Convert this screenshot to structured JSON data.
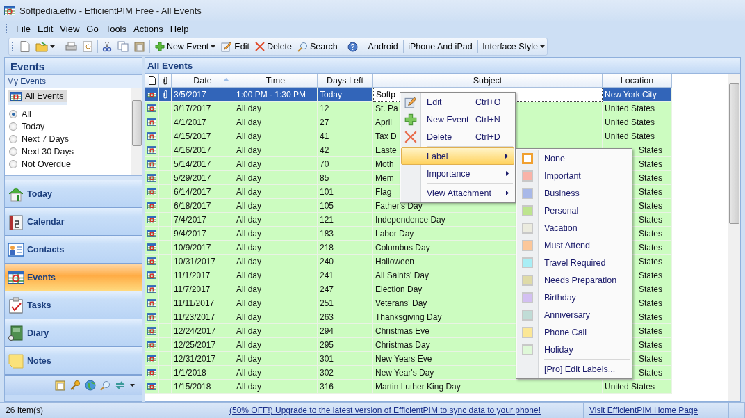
{
  "window": {
    "title": "Softpedia.effw - EfficientPIM Free - All Events"
  },
  "menu_bar": [
    "File",
    "Edit",
    "View",
    "Go",
    "Tools",
    "Actions",
    "Help"
  ],
  "toolbar": {
    "actions": [
      {
        "label": "New Event",
        "dropdown": true
      },
      {
        "label": "Edit",
        "dropdown": false
      },
      {
        "label": "Delete",
        "dropdown": false
      },
      {
        "label": "Search",
        "dropdown": false
      }
    ],
    "links": [
      {
        "label": "Android",
        "dropdown": false
      },
      {
        "label": "iPhone And iPad",
        "dropdown": false
      },
      {
        "label": "Interface Style",
        "dropdown": true
      }
    ]
  },
  "sidebar": {
    "title": "Events",
    "section": "My Events",
    "views": [
      {
        "label": "All Events",
        "selected": true
      }
    ],
    "filters": [
      {
        "label": "All",
        "selected": true
      },
      {
        "label": "Today",
        "selected": false
      },
      {
        "label": "Next 7 Days",
        "selected": false
      },
      {
        "label": "Next 30 Days",
        "selected": false
      },
      {
        "label": "Not Overdue",
        "selected": false
      }
    ],
    "nav": [
      {
        "label": "Today",
        "selected": false
      },
      {
        "label": "Calendar",
        "selected": false
      },
      {
        "label": "Contacts",
        "selected": false
      },
      {
        "label": "Events",
        "selected": true
      },
      {
        "label": "Tasks",
        "selected": false
      },
      {
        "label": "Diary",
        "selected": false
      },
      {
        "label": "Notes",
        "selected": false
      }
    ]
  },
  "table": {
    "title": "All Events",
    "columns": [
      {
        "label": "Date",
        "sorted": true
      },
      {
        "label": "Time",
        "sorted": false
      },
      {
        "label": "Days Left",
        "sorted": false
      },
      {
        "label": "Subject",
        "sorted": false
      },
      {
        "label": "Location",
        "sorted": false
      }
    ],
    "rows": [
      {
        "date": "3/5/2017",
        "time": "1:00 PM - 1:30 PM",
        "days_left": "Today",
        "subject": "Softp",
        "location": "New York City",
        "selected": true,
        "attachment": true,
        "location_cut": false
      },
      {
        "date": "3/17/2017",
        "time": "All day",
        "days_left": "12",
        "subject": "St. Pa",
        "location": "United States",
        "selected": false,
        "attachment": false,
        "location_cut": false
      },
      {
        "date": "4/1/2017",
        "time": "All day",
        "days_left": "27",
        "subject": "April",
        "location": "United States",
        "selected": false,
        "attachment": false,
        "location_cut": false
      },
      {
        "date": "4/15/2017",
        "time": "All day",
        "days_left": "41",
        "subject": "Tax D",
        "location": "United States",
        "selected": false,
        "attachment": false,
        "location_cut": false
      },
      {
        "date": "4/16/2017",
        "time": "All day",
        "days_left": "42",
        "subject": "Easte",
        "location": "States",
        "selected": false,
        "attachment": false,
        "location_cut": true
      },
      {
        "date": "5/14/2017",
        "time": "All day",
        "days_left": "70",
        "subject": "Moth",
        "location": "States",
        "selected": false,
        "attachment": false,
        "location_cut": true
      },
      {
        "date": "5/29/2017",
        "time": "All day",
        "days_left": "85",
        "subject": "Mem",
        "location": "States",
        "selected": false,
        "attachment": false,
        "location_cut": true
      },
      {
        "date": "6/14/2017",
        "time": "All day",
        "days_left": "101",
        "subject": "Flag",
        "location": "States",
        "selected": false,
        "attachment": false,
        "location_cut": true
      },
      {
        "date": "6/18/2017",
        "time": "All day",
        "days_left": "105",
        "subject": "Father's Day",
        "location": "States",
        "selected": false,
        "attachment": false,
        "location_cut": true
      },
      {
        "date": "7/4/2017",
        "time": "All day",
        "days_left": "121",
        "subject": "Independence Day",
        "location": "States",
        "selected": false,
        "attachment": false,
        "location_cut": true
      },
      {
        "date": "9/4/2017",
        "time": "All day",
        "days_left": "183",
        "subject": "Labor Day",
        "location": "States",
        "selected": false,
        "attachment": false,
        "location_cut": true
      },
      {
        "date": "10/9/2017",
        "time": "All day",
        "days_left": "218",
        "subject": "Columbus Day",
        "location": "States",
        "selected": false,
        "attachment": false,
        "location_cut": true
      },
      {
        "date": "10/31/2017",
        "time": "All day",
        "days_left": "240",
        "subject": "Halloween",
        "location": "States",
        "selected": false,
        "attachment": false,
        "location_cut": true
      },
      {
        "date": "11/1/2017",
        "time": "All day",
        "days_left": "241",
        "subject": "All Saints' Day",
        "location": "States",
        "selected": false,
        "attachment": false,
        "location_cut": true
      },
      {
        "date": "11/7/2017",
        "time": "All day",
        "days_left": "247",
        "subject": "Election Day",
        "location": "States",
        "selected": false,
        "attachment": false,
        "location_cut": true
      },
      {
        "date": "11/11/2017",
        "time": "All day",
        "days_left": "251",
        "subject": "Veterans' Day",
        "location": "States",
        "selected": false,
        "attachment": false,
        "location_cut": true
      },
      {
        "date": "11/23/2017",
        "time": "All day",
        "days_left": "263",
        "subject": "Thanksgiving Day",
        "location": "States",
        "selected": false,
        "attachment": false,
        "location_cut": true
      },
      {
        "date": "12/24/2017",
        "time": "All day",
        "days_left": "294",
        "subject": "Christmas Eve",
        "location": "States",
        "selected": false,
        "attachment": false,
        "location_cut": true
      },
      {
        "date": "12/25/2017",
        "time": "All day",
        "days_left": "295",
        "subject": "Christmas Day",
        "location": "States",
        "selected": false,
        "attachment": false,
        "location_cut": true
      },
      {
        "date": "12/31/2017",
        "time": "All day",
        "days_left": "301",
        "subject": "New Years Eve",
        "location": "States",
        "selected": false,
        "attachment": false,
        "location_cut": true
      },
      {
        "date": "1/1/2018",
        "time": "All day",
        "days_left": "302",
        "subject": "New Year's Day",
        "location": "States",
        "selected": false,
        "attachment": false,
        "location_cut": true
      },
      {
        "date": "1/15/2018",
        "time": "All day",
        "days_left": "316",
        "subject": "Martin Luther King Day",
        "location": "United States",
        "selected": false,
        "attachment": false,
        "location_cut": false
      }
    ]
  },
  "context_menu": {
    "items": [
      {
        "kind": "item",
        "label": "Edit",
        "shortcut": "Ctrl+O"
      },
      {
        "kind": "item",
        "label": "New Event",
        "shortcut": "Ctrl+N"
      },
      {
        "kind": "item",
        "label": "Delete",
        "shortcut": "Ctrl+D"
      },
      {
        "kind": "separator"
      },
      {
        "kind": "submenu",
        "label": "Label",
        "selected": true
      },
      {
        "kind": "submenu",
        "label": "Importance",
        "selected": false
      },
      {
        "kind": "separator"
      },
      {
        "kind": "submenu",
        "label": "View Attachment",
        "selected": false
      }
    ]
  },
  "label_menu": {
    "labels": [
      {
        "label": "None",
        "color": "#ffffff",
        "selected": true
      },
      {
        "label": "Important",
        "color": "#f9b3a8",
        "selected": false
      },
      {
        "label": "Business",
        "color": "#a8b8e8",
        "selected": false
      },
      {
        "label": "Personal",
        "color": "#bde48f",
        "selected": false
      },
      {
        "label": "Vacation",
        "color": "#ebebdf",
        "selected": false
      },
      {
        "label": "Must Attend",
        "color": "#fcc79a",
        "selected": false
      },
      {
        "label": "Travel Required",
        "color": "#a8eef5",
        "selected": false
      },
      {
        "label": "Needs Preparation",
        "color": "#dfdba8",
        "selected": false
      },
      {
        "label": "Birthday",
        "color": "#d3c0f2",
        "selected": false
      },
      {
        "label": "Anniversary",
        "color": "#c0dcd6",
        "selected": false
      },
      {
        "label": "Phone Call",
        "color": "#fbe796",
        "selected": false
      },
      {
        "label": "Holiday",
        "color": "#dff8d8",
        "selected": false
      }
    ],
    "footer": "[Pro] Edit Labels..."
  },
  "status_bar": {
    "count": "26 Item(s)",
    "promo_link": "(50% OFF!) Upgrade to the latest version of EfficientPIM to sync data to your phone!",
    "home_link": "Visit EfficientPIM Home Page"
  }
}
